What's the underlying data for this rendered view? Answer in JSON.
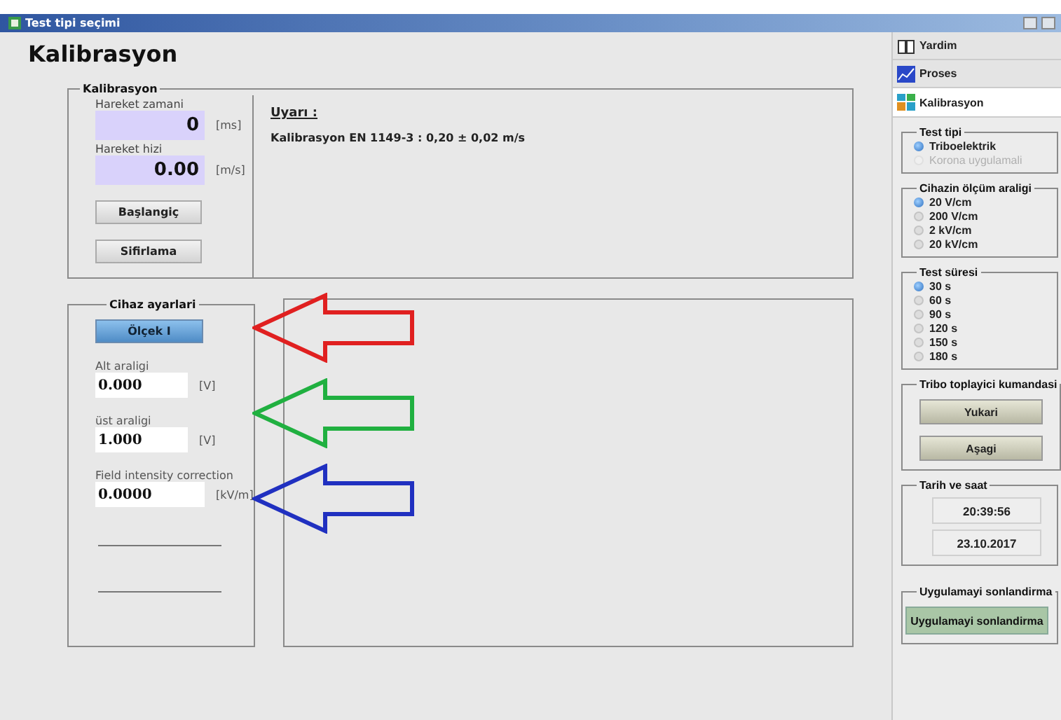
{
  "window": {
    "title": "Test tipi seçimi"
  },
  "heading": "Kalibrasyon",
  "calibration": {
    "title": "Kalibrasyon",
    "fields": [
      {
        "label": "Hareket zamani",
        "value": "0",
        "unit": "[ms]"
      },
      {
        "label": "Hareket hizi",
        "value": "0.00",
        "unit": "[m/s]"
      }
    ],
    "buttons": [
      "Başlangiç",
      "Sifirlama"
    ],
    "warning_title": "Uyarı :",
    "warning": "Kalibrasyon EN 1149-3 : 0,20 ± 0,02 m/s"
  },
  "device": {
    "title": "Cihaz ayarlari",
    "scale_button": {
      "label": "Ölçek I",
      "selected": true
    },
    "fields": [
      {
        "kind": "input",
        "label": "Alt araligi",
        "value": "0.000",
        "unit": "[V]"
      },
      {
        "kind": "input",
        "label": "üst araligi",
        "value": "1.000",
        "unit": "[V]"
      },
      {
        "kind": "input",
        "label": "Field intensity correction",
        "value": "0.0000",
        "unit": "[kV/m]"
      },
      {
        "kind": "line"
      },
      {
        "kind": "line"
      }
    ]
  },
  "arrows": [
    {
      "color": "#e02020"
    },
    {
      "color": "#20b040"
    },
    {
      "color": "#2030c0"
    }
  ],
  "sidebar": {
    "items": [
      {
        "label": "Yardim",
        "selected": false
      },
      {
        "label": "Proses",
        "selected": false
      },
      {
        "label": "Kalibrasyon",
        "selected": true
      }
    ],
    "groups": [
      {
        "kind": "radio",
        "title": "Test tipi",
        "options": [
          {
            "label": "Triboelektrik",
            "selected": true,
            "disabled": false
          },
          {
            "label": "Korona uygulamali",
            "selected": false,
            "disabled": true
          }
        ]
      },
      {
        "kind": "radio",
        "title": "Cihazin ölçüm araligi",
        "options": [
          {
            "label": "20 V/cm",
            "selected": true,
            "disabled": false
          },
          {
            "label": "200 V/cm",
            "selected": false,
            "disabled": false
          },
          {
            "label": "2 kV/cm",
            "selected": false,
            "disabled": false
          },
          {
            "label": "20 kV/cm",
            "selected": false,
            "disabled": false
          }
        ]
      },
      {
        "kind": "radio",
        "title": "Test süresi",
        "options": [
          {
            "label": "30 s",
            "selected": true,
            "disabled": false
          },
          {
            "label": "60 s",
            "selected": false,
            "disabled": false
          },
          {
            "label": "90 s",
            "selected": false,
            "disabled": false
          },
          {
            "label": "120 s",
            "selected": false,
            "disabled": false
          },
          {
            "label": "150 s",
            "selected": false,
            "disabled": false
          },
          {
            "label": "180 s",
            "selected": false,
            "disabled": false
          }
        ]
      },
      {
        "kind": "buttons",
        "title": "Tribo toplayici kumandasi",
        "buttons": [
          "Yukari",
          "Aşagi"
        ]
      },
      {
        "kind": "display",
        "title": "Tarih ve saat",
        "values": [
          "20:39:56",
          "23.10.2017"
        ]
      },
      {
        "kind": "exit",
        "title": "Uygulamayi sonlandirma",
        "buttons": [
          "Uygulamayi sonlandirma"
        ]
      }
    ]
  }
}
